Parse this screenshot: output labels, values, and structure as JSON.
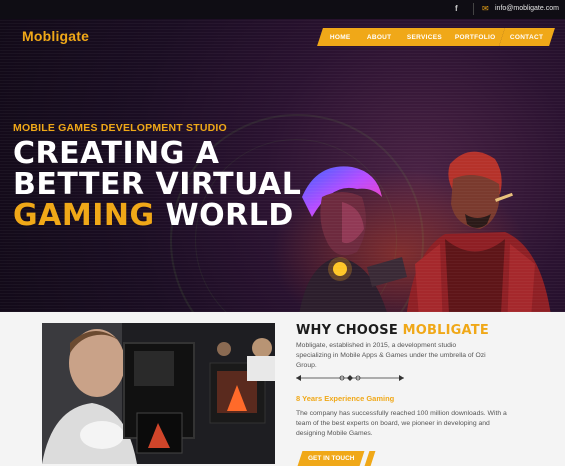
{
  "topbar": {
    "facebook_icon": "f",
    "mail_icon": "✉",
    "email": "info@mobligate.com"
  },
  "brand": {
    "logo": "Mobligate"
  },
  "nav": [
    "HOME",
    "ABOUT",
    "SERVICES",
    "PORTFOLIO",
    "CONTACT"
  ],
  "hero": {
    "kicker": "MOBILE GAMES DEVELOPMENT STUDIO",
    "line1": "CREATING A",
    "line2": "BETTER VIRTUAL",
    "line3_accent": "GAMING",
    "line3_rest": " WORLD"
  },
  "about": {
    "title_prefix": "WHY CHOOSE ",
    "title_accent": "MOBLIGATE",
    "intro_lines": [
      "Mobligate, established in 2015, a development studio",
      "specializing in Mobile Apps & Games under the umbrella of Ozi",
      "Group."
    ],
    "experience": "8 Years Experience Gaming",
    "body_lines": [
      "The company has successfully reached 100 million downloads. With a",
      "team of the best experts on board, we pioneer in developing and",
      "designing Mobile Games."
    ],
    "cta": "GET IN TOUCH"
  },
  "colors": {
    "accent": "#f0a818",
    "dark": "#120a18"
  }
}
